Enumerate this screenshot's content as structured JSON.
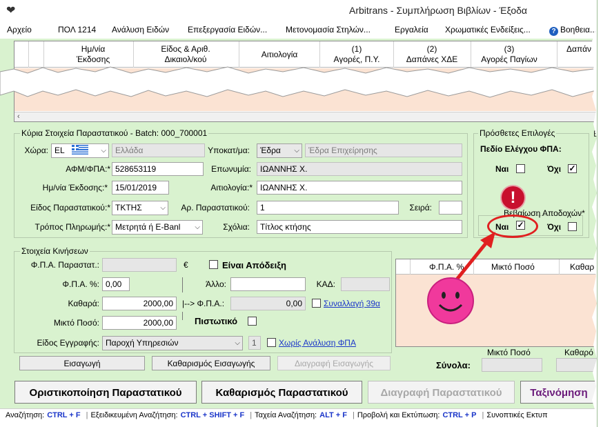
{
  "window": {
    "title": "Arbitrans - Συμπλήρωση Βιβλίων - Έξοδα"
  },
  "menu": {
    "items": [
      "Αρχείο",
      "ΠΟΛ 1214",
      "Ανάλυση Ειδών",
      "Επεξεργασία Ειδών...",
      "Μετονομασία Στηλών...",
      "Εργαλεία",
      "Χρωματικές Ενδείξεις...",
      "Βοηθεια..."
    ]
  },
  "grid": {
    "columns": [
      {
        "l1": "Ημ/νία",
        "l2": "Έκδοσης"
      },
      {
        "l1": "Είδος & Αριθ.",
        "l2": "Δικαιολ/κού"
      },
      {
        "l1": "Αιτιολογία",
        "l2": ""
      },
      {
        "l1": "(1)",
        "l2": "Αγορές, Π.Υ."
      },
      {
        "l1": "(2)",
        "l2": "Δαπάνες ΧΔΕ"
      },
      {
        "l1": "(3)",
        "l2": "Αγορές Παγίων"
      },
      {
        "l1": "",
        "l2": "Δαπάν"
      }
    ]
  },
  "main_section": {
    "title": "Κύρια Στοιχεία Παραστατικού - Batch: 000_700001",
    "country_label": "Χώρα:",
    "country_code": "EL",
    "country_name": "Ελλάδα",
    "branch_label": "Υποκατ/μα:",
    "branch_value": "Έδρα",
    "branch_name": "Έδρα Επιχείρησης",
    "afm_label": "ΑΦΜ/ΦΠΑ:*",
    "afm_value": "528653119",
    "name_label": "Επωνυμία:",
    "name_value": "ΙΩΑΝΝΗΣ Χ.",
    "date_label": "Ημ/νία Έκδοσης:*",
    "date_value": "15/01/2019",
    "reason_label": "Αιτιολογία:*",
    "reason_value": "ΙΩΑΝΝΗΣ Χ.",
    "doctype_label": "Είδος Παραστατικού:*",
    "doctype_value": "ΤΚΤΗΣ",
    "docnum_label": "Αρ. Παραστατικού:",
    "docnum_value": "1",
    "series_label": "Σειρά:",
    "series_value": "",
    "payment_label": "Τρόπος Πληρωμής:*",
    "payment_value": "Μετρητά ή E-Banl",
    "comments_label": "Σχόλια:",
    "comments_value": "Τίτλος κτήσης"
  },
  "extra_options": {
    "title": "Πρόσθετες Επιλογές",
    "vat_check_title": "Πεδίο Ελέγχου ΦΠΑ:",
    "yes_label": "Ναι",
    "no_label": "Όχι",
    "vat_yes_checked": false,
    "vat_no_checked": true,
    "receipts_title": "Βεβαίωση Αποδοχών*",
    "receipts_yes_checked": true,
    "receipts_no_checked": false,
    "right_cut": "E"
  },
  "movements": {
    "title": "Στοιχεία Κινήσεων",
    "vat_doc_label": "Φ.Π.Α. Παραστατ.:",
    "vat_doc_value": "",
    "currency": "€",
    "is_receipt_label": "Είναι Απόδειξη",
    "vat_pct_label": "Φ.Π.Α. %:",
    "vat_pct_value": "0,00",
    "other_label": "Άλλο:",
    "other_value": "",
    "kad_label": "ΚΑΔ:",
    "kad_value": "",
    "net_label": "Καθαρά:",
    "net_value": "2000,00",
    "arrow_vat_label": "|--> Φ.Π.Α.:",
    "arrow_vat_value": "0,00",
    "trans39_link": "Συναλλαγή 39α",
    "gross_label": "Μικτό Ποσό:",
    "gross_value": "2000,00",
    "credit_label": "Πιστωτικό",
    "entry_type_label": "Είδος Εγγραφής:",
    "entry_type_value": "Παροχή Υπηρεσιών",
    "entry_type_num": "1",
    "no_vat_link": "Χωρίς Ανάλυση ΦΠΑ"
  },
  "subgrid": {
    "columns": [
      "Φ.Π.Α. %",
      "Μικτό Ποσό",
      "Καθαρ"
    ]
  },
  "totals": {
    "label": "Σύνολα:",
    "gross_header": "Μικτό Ποσό",
    "net_header": "Καθαρό"
  },
  "buttons": {
    "insert": "Εισαγωγή",
    "clear_insert": "Καθαρισμός Εισαγωγής",
    "delete_insert": "Διαγραφή Εισαγωγής",
    "finalize": "Οριστικοποίηση Παραστατικού",
    "clear_doc": "Καθαρισμός Παραστατικού",
    "delete_doc": "Διαγραφή Παραστατικού",
    "sort": "Ταξινόμηση"
  },
  "statusbar": {
    "items": [
      {
        "label": "Αναζήτηση:",
        "key": "CTRL + F"
      },
      {
        "label": "Εξειδικευμένη Αναζήτηση:",
        "key": "CTRL + SHIFT + F"
      },
      {
        "label": "Ταχεία Αναζήτηση:",
        "key": "ALT + F"
      },
      {
        "label": "Προβολή και Εκτύπωση:",
        "key": "CTRL + P"
      },
      {
        "label": "Συνοπτικές Εκτυπ",
        "key": ""
      }
    ]
  },
  "annotations": {
    "warning_symbol": "!"
  },
  "colors": {
    "window_bg": "#d9f2cf",
    "grid_body": "#fbe3d3",
    "link": "#1a35c9",
    "annotation_red": "#e02020",
    "smiley": "#f0399c",
    "sort_text": "#6a1a7a"
  }
}
